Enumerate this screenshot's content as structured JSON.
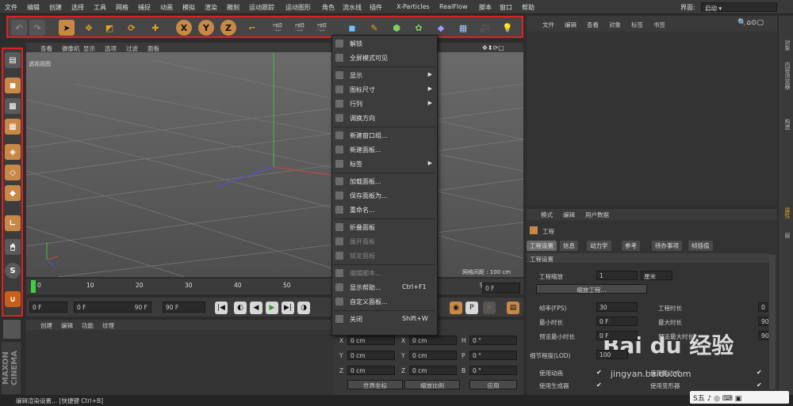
{
  "menubar": {
    "items": [
      "文件",
      "编辑",
      "创建",
      "选择",
      "工具",
      "网格",
      "捕捉",
      "动画",
      "模拟",
      "渲染",
      "雕刻",
      "运动跟踪",
      "运动图形",
      "角色",
      "流水线",
      "插件",
      "X-Particles",
      "RealFlow",
      "脚本",
      "窗口",
      "帮助"
    ],
    "layout_label": "界面:",
    "layout_value": "启动"
  },
  "toolbar": {
    "x_axis": "X",
    "y_axis": "Y",
    "z_axis": "Z"
  },
  "viewport": {
    "menus": [
      "查看",
      "摄像机",
      "显示",
      "选项",
      "过滤",
      "面板"
    ],
    "label": "透视视图",
    "grid_spacing": "网格间距 : 100 cm"
  },
  "timeline": {
    "ticks": [
      "0",
      "10",
      "20",
      "30",
      "40",
      "50",
      "60",
      "70",
      "80",
      "90"
    ],
    "end_frame": "0 F"
  },
  "playbar": {
    "current": "0 F",
    "range_start": "0 F",
    "range_end": "90 F",
    "max": "90 F"
  },
  "material": {
    "menus": [
      "创建",
      "编辑",
      "功能",
      "纹理"
    ]
  },
  "coords": {
    "rows": [
      {
        "a": "X",
        "av": "0 cm",
        "b": "X",
        "bv": "0 cm",
        "c": "H",
        "cv": "0 °"
      },
      {
        "a": "Y",
        "av": "0 cm",
        "b": "Y",
        "bv": "0 cm",
        "c": "P",
        "cv": "0 °"
      },
      {
        "a": "Z",
        "av": "0 cm",
        "b": "Z",
        "bv": "0 cm",
        "c": "B",
        "cv": "0 °"
      }
    ],
    "world": "世界坐标",
    "scale": "缩放比例",
    "apply": "应用"
  },
  "status": "编辑渲染设置... [快捷键 Ctrl+B]",
  "objects": {
    "menus": [
      "文件",
      "编辑",
      "查看",
      "对象",
      "标签",
      "书签"
    ]
  },
  "attributes": {
    "menus": [
      "模式",
      "编辑",
      "用户数据"
    ],
    "title": "工程",
    "tabs": [
      "工程设置",
      "信息",
      "动力学",
      "参考",
      "待办事项",
      "帧插值"
    ],
    "section": "工程设置",
    "scale_label": "工程缩放",
    "scale_value": "1",
    "scale_unit": "厘米",
    "scale_button": "缩放工程...",
    "fps_label": "帧率(FPS)",
    "fps_value": "30",
    "duration_label": "工程时长",
    "duration_value": "0",
    "min_label": "最小时长",
    "min_value": "0 F",
    "max_label": "最大时长",
    "max_value": "90",
    "preview_min_label": "预览最小时长",
    "preview_min_value": "0 F",
    "preview_max_label": "预览最大时长",
    "preview_max_value": "90",
    "lod_label": "细节程度(LOD)",
    "lod_value": "100",
    "anim_label": "使用动画",
    "gen_label": "使用生成器",
    "expr_label": "使用表达式",
    "deform_label": "使用变形器"
  },
  "right_tabs": [
    "对象",
    "内容浏览器",
    "构造",
    "属性",
    "层"
  ],
  "context_menu": [
    {
      "label": "解锁",
      "disabled": false
    },
    {
      "label": "全屏模式可见",
      "disabled": false
    },
    {
      "label": "显示",
      "disabled": false,
      "sub": true
    },
    {
      "label": "图标尺寸",
      "disabled": false,
      "sub": true
    },
    {
      "label": "行列",
      "disabled": false,
      "sub": true
    },
    {
      "label": "调换方向",
      "disabled": false
    },
    {
      "label": "新建窗口组...",
      "disabled": false
    },
    {
      "label": "新建面板...",
      "disabled": false
    },
    {
      "label": "标签",
      "disabled": false,
      "sub": true
    },
    {
      "label": "加载面板...",
      "disabled": false
    },
    {
      "label": "保存面板为...",
      "disabled": false
    },
    {
      "label": "重命名...",
      "disabled": false
    },
    {
      "label": "折叠面板",
      "disabled": false
    },
    {
      "label": "展开面板",
      "disabled": true
    },
    {
      "label": "锁定面板",
      "disabled": true
    },
    {
      "label": "编辑脚本...",
      "disabled": true
    },
    {
      "label": "显示帮助...",
      "disabled": false,
      "shortcut": "Ctrl+F1"
    },
    {
      "label": "自定义面板...",
      "disabled": false
    },
    {
      "label": "关闭",
      "disabled": false,
      "shortcut": "Shift+W"
    }
  ],
  "watermark": {
    "brand": "Bai du 经验",
    "url": "jingyan.baidu.com"
  },
  "tray": "S五 ♪ ◎ ⌨ ▣"
}
